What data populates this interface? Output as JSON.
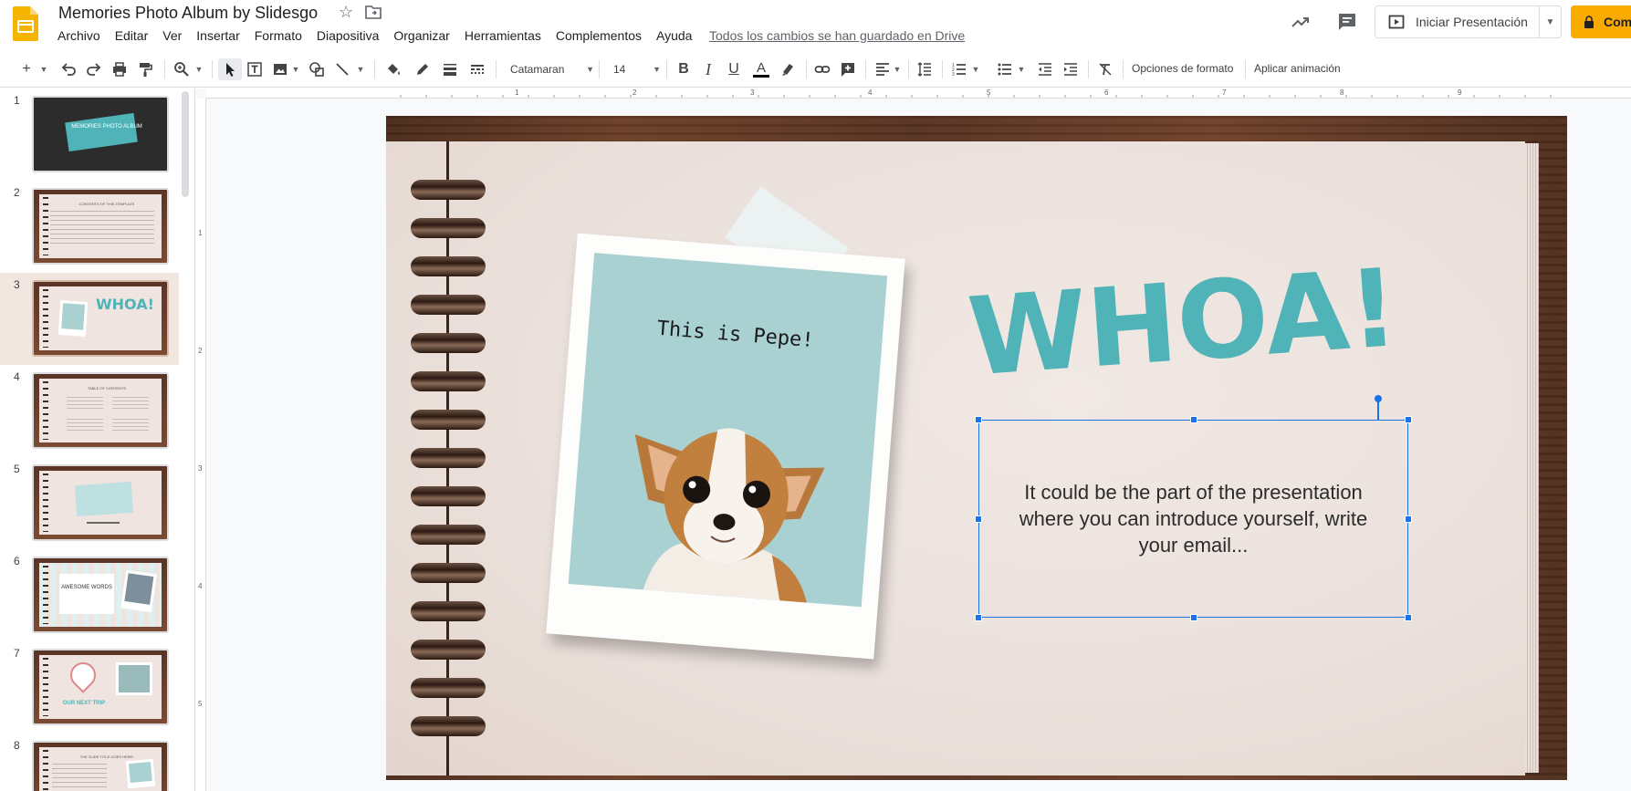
{
  "app": {
    "doc_title": "Memories Photo Album by Slidesgo",
    "save_status": "Todos los cambios se han guardado en Drive",
    "present_label": "Iniciar Presentación",
    "share_label": "Comp",
    "accent_color": "#f9ab00",
    "selection_color": "#1a73e8"
  },
  "menu": [
    "Archivo",
    "Editar",
    "Ver",
    "Insertar",
    "Formato",
    "Diapositiva",
    "Organizar",
    "Herramientas",
    "Complementos",
    "Ayuda"
  ],
  "toolbar": {
    "font": "Catamaran",
    "font_size": "14",
    "format_options": "Opciones de formato",
    "animation": "Aplicar animación"
  },
  "ruler": {
    "h": [
      "1",
      "2",
      "3",
      "4",
      "5",
      "6",
      "7",
      "8",
      "9"
    ],
    "v": [
      "1",
      "2",
      "3",
      "4",
      "5"
    ]
  },
  "filmstrip": {
    "selected_index": 3,
    "slides": [
      {
        "num": "1",
        "text": "MEMORIES PHOTO ALBUM"
      },
      {
        "num": "2",
        "text": "CONTENTS OF THIS TEMPLATE"
      },
      {
        "num": "3",
        "text": "WHOA!"
      },
      {
        "num": "4",
        "text": "TABLE OF CONTENTS"
      },
      {
        "num": "5",
        "text": ""
      },
      {
        "num": "6",
        "text": "AWESOME WORDS"
      },
      {
        "num": "7",
        "text": "OUR NEXT TRIP"
      },
      {
        "num": "8",
        "text": "THE SLIDE TITLE GOES HERE!"
      }
    ]
  },
  "slide": {
    "title": "WHOA!",
    "photo_caption": "This is Pepe!",
    "body": "It could be the part of the presentation where you can introduce yourself, write your email...",
    "title_color": "#4fb3b7"
  }
}
